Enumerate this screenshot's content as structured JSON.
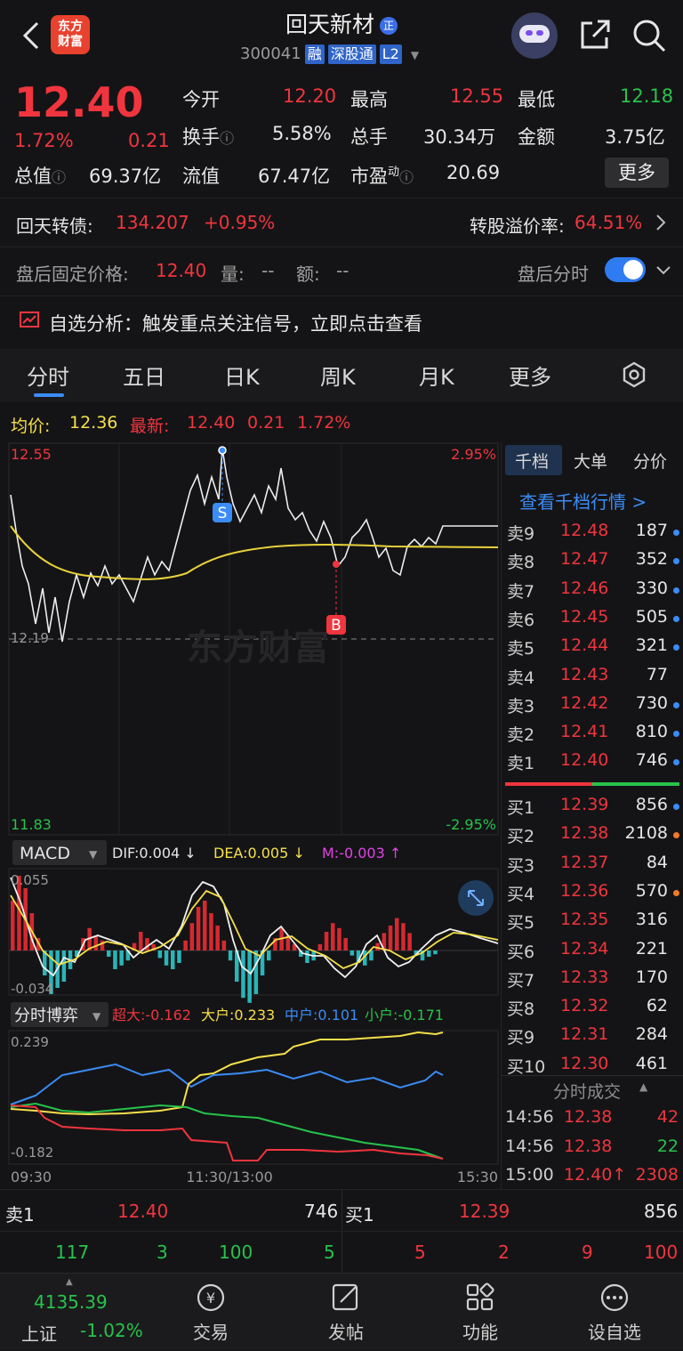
{
  "header": {
    "logo_text": "东方财富",
    "title": "回天新材",
    "badge": "正",
    "code": "300041",
    "tags": [
      "融",
      "深股通",
      "L2"
    ]
  },
  "quote": {
    "price": "12.40",
    "change_pct": "1.72%",
    "change": "0.21",
    "open_label": "今开",
    "open": "12.20",
    "high_label": "最高",
    "high": "12.55",
    "low_label": "最低",
    "low": "12.18",
    "turnover_label": "换手",
    "turnover": "5.58%",
    "volume_label": "总手",
    "volume": "30.34万",
    "amount_label": "金额",
    "amount": "3.75亿",
    "mcap_label": "总值",
    "mcap": "69.37亿",
    "float_label": "流值",
    "float": "67.47亿",
    "pe_label": "市盈",
    "pe_sup": "动",
    "pe": "20.69",
    "more": "更多"
  },
  "bond": {
    "label": "回天转债:",
    "price": "134.207",
    "change": "+0.95%",
    "premium_label": "转股溢价率:",
    "premium": "64.51%"
  },
  "afterhours": {
    "label": "盘后固定价格:",
    "price": "12.40",
    "vol_label": "量:",
    "vol": "--",
    "amt_label": "额:",
    "amt": "--",
    "toggle_label": "盘后分时"
  },
  "signal": {
    "text": "自选分析：触发重点关注信号，立即点击查看"
  },
  "tabs": [
    "分时",
    "五日",
    "日K",
    "周K",
    "月K",
    "更多"
  ],
  "avgline": {
    "avg_label": "均价:",
    "avg": "12.36",
    "latest_label": "最新:",
    "latest": "12.40",
    "chg": "0.21",
    "pct": "1.72%"
  },
  "chart": {
    "ymax": "12.55",
    "ymin": "11.83",
    "ymid": "12.19",
    "pmax": "2.95%",
    "pmin": "-2.95%",
    "watermark": "东方财富",
    "marker_s": "S",
    "marker_b": "B",
    "macd_label": "MACD",
    "dif": "DIF:0.004 ↓",
    "dea": "DEA:0.005 ↓",
    "m": "M:-0.003 ↑",
    "macd_max": "0.055",
    "macd_min": "-0.034",
    "flow_label": "分时博弈",
    "super": "超大:-0.162",
    "large": "大户:0.233",
    "mid": "中户:0.101",
    "small": "小户:-0.171",
    "flow_max": "0.239",
    "flow_min": "-0.182",
    "t_start": "09:30",
    "t_mid": "11:30/13:00",
    "t_end": "15:30"
  },
  "orderbook": {
    "tabs": [
      "千档",
      "大单",
      "分价"
    ],
    "link": "查看千档行情 >",
    "asks": [
      {
        "l": "卖9",
        "p": "12.48",
        "v": "187",
        "c": "#3b8cf6"
      },
      {
        "l": "卖8",
        "p": "12.47",
        "v": "352",
        "c": "#3b8cf6"
      },
      {
        "l": "卖7",
        "p": "12.46",
        "v": "330",
        "c": "#3b8cf6"
      },
      {
        "l": "卖6",
        "p": "12.45",
        "v": "505",
        "c": "#3b8cf6"
      },
      {
        "l": "卖5",
        "p": "12.44",
        "v": "321",
        "c": "#3b8cf6"
      },
      {
        "l": "卖4",
        "p": "12.43",
        "v": "77",
        "c": ""
      },
      {
        "l": "卖3",
        "p": "12.42",
        "v": "730",
        "c": "#3b8cf6"
      },
      {
        "l": "卖2",
        "p": "12.41",
        "v": "810",
        "c": "#3b8cf6"
      },
      {
        "l": "卖1",
        "p": "12.40",
        "v": "746",
        "c": "#3b8cf6"
      }
    ],
    "bids": [
      {
        "l": "买1",
        "p": "12.39",
        "v": "856",
        "c": "#3b8cf6"
      },
      {
        "l": "买2",
        "p": "12.38",
        "v": "2108",
        "c": "#f07a2a"
      },
      {
        "l": "买3",
        "p": "12.37",
        "v": "84",
        "c": ""
      },
      {
        "l": "买4",
        "p": "12.36",
        "v": "570",
        "c": "#f07a2a"
      },
      {
        "l": "买5",
        "p": "12.35",
        "v": "316",
        "c": ""
      },
      {
        "l": "买6",
        "p": "12.34",
        "v": "221",
        "c": ""
      },
      {
        "l": "买7",
        "p": "12.33",
        "v": "170",
        "c": ""
      },
      {
        "l": "买8",
        "p": "12.32",
        "v": "62",
        "c": ""
      },
      {
        "l": "买9",
        "p": "12.31",
        "v": "284",
        "c": ""
      },
      {
        "l": "买10",
        "p": "12.30",
        "v": "461",
        "c": ""
      }
    ],
    "trades_label": "分时成交",
    "trades": [
      {
        "t": "14:56",
        "p": "12.38",
        "v": "42",
        "c": "#f0353e"
      },
      {
        "t": "14:56",
        "p": "12.38",
        "v": "22",
        "c": "#27c24c"
      },
      {
        "t": "15:00",
        "p": "12.40↑",
        "v": "2308",
        "c": "#f0353e"
      }
    ]
  },
  "bidask": {
    "ask_label": "卖1",
    "ask_price": "12.40",
    "ask_vol": "746",
    "bid_label": "买1",
    "bid_price": "12.39",
    "bid_vol": "856",
    "ask_queue": [
      "117",
      "3",
      "100",
      "5"
    ],
    "bid_queue": [
      "5",
      "2",
      "9",
      "100"
    ]
  },
  "nav": {
    "index_value": "4135.39",
    "index_name": "上证",
    "index_change": "-1.02%",
    "items": [
      "交易",
      "发帖",
      "功能",
      "设自选"
    ]
  }
}
